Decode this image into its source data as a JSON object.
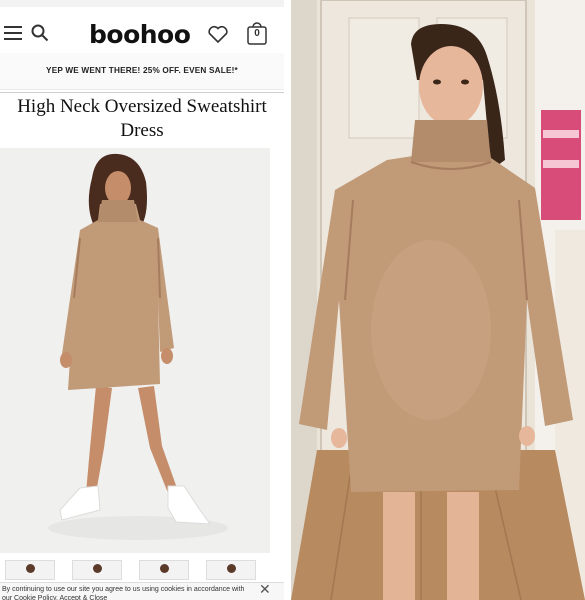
{
  "header": {
    "logo": "boohoo",
    "bag_count": "0"
  },
  "promo_banner": "YEP WE WENT THERE! 25% OFF. EVEN SALE!*",
  "product": {
    "title": "High Neck Oversized Sweatshirt Dress"
  },
  "cookie_banner": {
    "text": "By continuing to use our site you agree to us using cookies in accordance with our Cookie Policy. Accept & Close"
  },
  "icons": [
    "menu-icon",
    "search-icon",
    "heart-icon",
    "shopping-bag-icon",
    "close-icon"
  ],
  "colors": {
    "dress": "#c19a78",
    "dress_shadow": "#a57d5e",
    "photo_background": "#f0f0ef",
    "door": "#ece6dc",
    "floor": "#b78a5f"
  }
}
